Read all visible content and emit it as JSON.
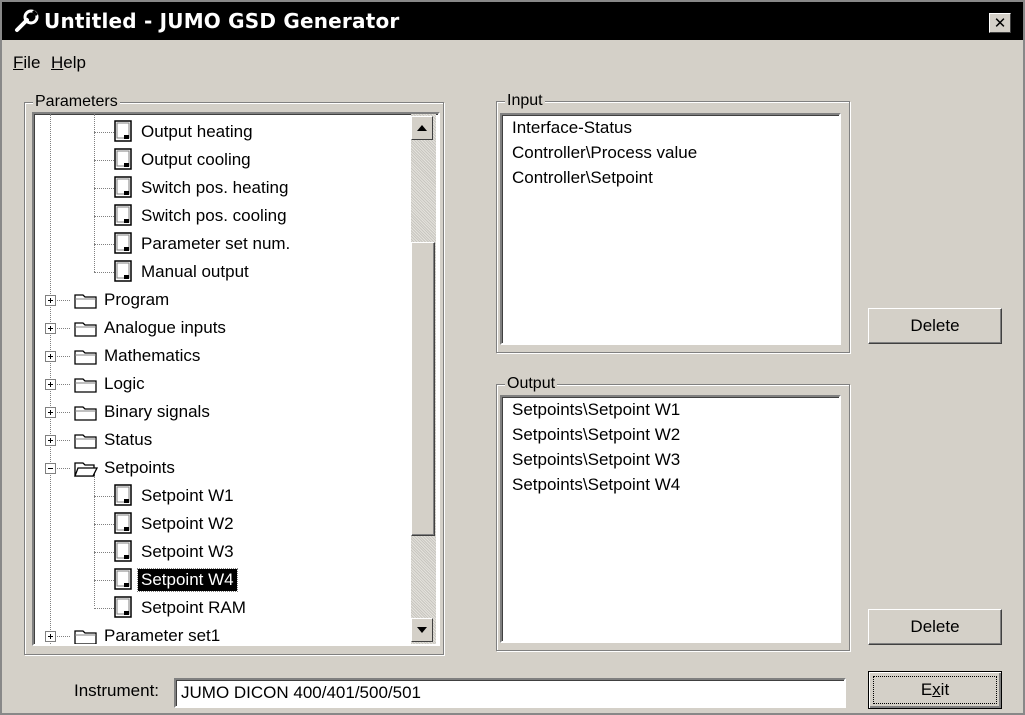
{
  "window": {
    "title": "Untitled - JUMO GSD Generator",
    "close_glyph": "✕",
    "app_icon": "wrench-icon"
  },
  "menu": {
    "file": "File",
    "help": "Help"
  },
  "parameters": {
    "label": "Parameters",
    "tree": [
      {
        "label": "Output heating",
        "kind": "item"
      },
      {
        "label": "Output cooling",
        "kind": "item"
      },
      {
        "label": "Switch pos. heating",
        "kind": "item"
      },
      {
        "label": "Switch pos. cooling",
        "kind": "item"
      },
      {
        "label": "Parameter set num.",
        "kind": "item"
      },
      {
        "label": "Manual output",
        "kind": "item"
      },
      {
        "label": "Program",
        "kind": "folder",
        "expanded": false
      },
      {
        "label": "Analogue inputs",
        "kind": "folder",
        "expanded": false
      },
      {
        "label": "Mathematics",
        "kind": "folder",
        "expanded": false
      },
      {
        "label": "Logic",
        "kind": "folder",
        "expanded": false
      },
      {
        "label": "Binary signals",
        "kind": "folder",
        "expanded": false
      },
      {
        "label": "Status",
        "kind": "folder",
        "expanded": false
      },
      {
        "label": "Setpoints",
        "kind": "folder",
        "expanded": true
      },
      {
        "label": "Setpoint W1",
        "kind": "item"
      },
      {
        "label": "Setpoint W2",
        "kind": "item"
      },
      {
        "label": "Setpoint W3",
        "kind": "item"
      },
      {
        "label": "Setpoint W4",
        "kind": "item",
        "selected": true
      },
      {
        "label": "Setpoint RAM",
        "kind": "item"
      },
      {
        "label": "Parameter set1",
        "kind": "folder",
        "expanded": false
      }
    ]
  },
  "input": {
    "label": "Input",
    "items": [
      "Interface-Status",
      "Controller\\Process value",
      "Controller\\Setpoint"
    ],
    "delete_label": "Delete"
  },
  "output": {
    "label": "Output",
    "items": [
      "Setpoints\\Setpoint W1",
      "Setpoints\\Setpoint W2",
      "Setpoints\\Setpoint W3",
      "Setpoints\\Setpoint W4"
    ],
    "delete_label": "Delete"
  },
  "instrument": {
    "label": "Instrument:",
    "value": "JUMO DICON 400/401/500/501"
  },
  "exit_label": "Exit",
  "colors": {
    "face": "#d4d0c8",
    "titlebar": "#000000",
    "selection": "#000000"
  }
}
